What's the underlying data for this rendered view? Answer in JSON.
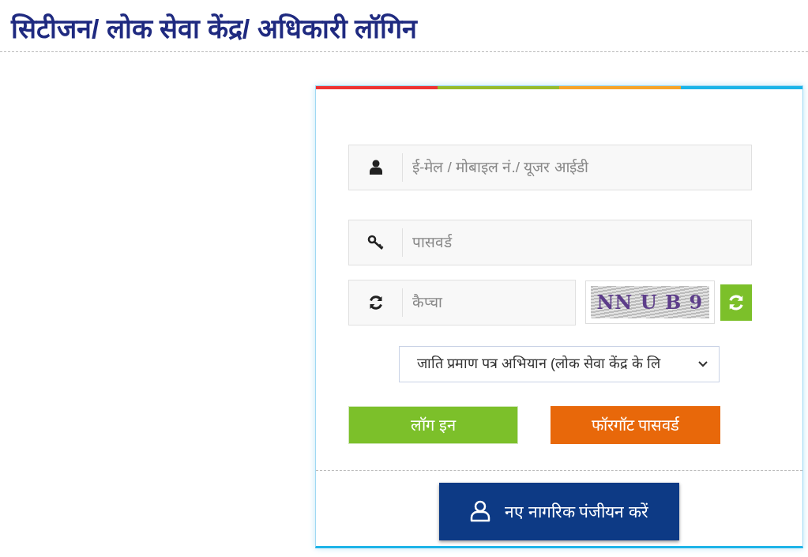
{
  "heading": "सिटीजन/ लोक सेवा केंद्र/ अधिकारी लॉगिन",
  "fields": [
    {
      "kind": "user",
      "placeholder": "ई-मेल / मोबाइल नं./ यूजर आईडी"
    },
    {
      "kind": "password",
      "placeholder": "पासवर्ड"
    }
  ],
  "captcha": {
    "placeholder": "कैप्चा",
    "image_text": "NN U B 9"
  },
  "portal_select": {
    "value": "जाति प्रमाण पत्र अभियान (लोक सेवा केंद्र के लि"
  },
  "buttons": [
    {
      "kind": "login",
      "label": "लॉग इन"
    },
    {
      "kind": "forgot",
      "label": "फॉरगॉट पासवर्ड"
    }
  ],
  "register_button": {
    "label": "नए नागरिक पंजीयन करें"
  }
}
